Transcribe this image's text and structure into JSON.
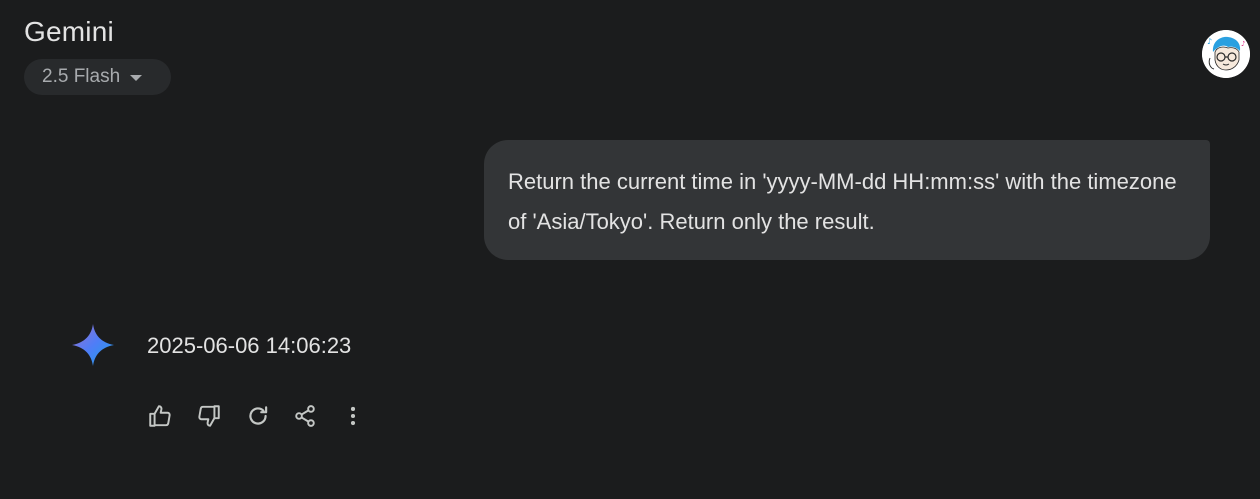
{
  "header": {
    "app_title": "Gemini",
    "model_selector": {
      "label": "2.5 Flash",
      "icon": "caret-down-icon"
    },
    "avatar_icon": "user-avatar"
  },
  "conversation": {
    "user_message": "Return the current time in 'yyyy-MM-dd HH:mm:ss' with the timezone of 'Asia/Tokyo'. Return only the result.",
    "model_icon": "gemini-spark-icon",
    "model_response": "2025-06-06 14:06:23",
    "actions": [
      {
        "name": "good-response",
        "icon": "thumb-up-icon"
      },
      {
        "name": "bad-response",
        "icon": "thumb-down-icon"
      },
      {
        "name": "redo",
        "icon": "refresh-icon"
      },
      {
        "name": "share",
        "icon": "share-icon"
      },
      {
        "name": "more",
        "icon": "more-vert-icon"
      }
    ]
  },
  "colors": {
    "background": "#1b1c1d",
    "user_bubble": "#333537",
    "chip": "#282a2c",
    "text": "#e3e3e3",
    "muted_text": "#a8abae",
    "icon": "#c4c7c5"
  }
}
